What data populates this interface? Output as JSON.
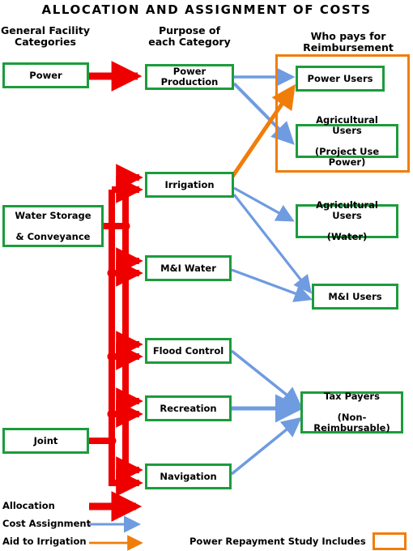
{
  "title": "ALLOCATION AND ASSIGNMENT OF COSTS",
  "columns": {
    "facility": "General Facility\nCategories",
    "purpose": "Purpose of\neach Category",
    "payer": "Who pays for\nReimbursement"
  },
  "column_headers": {
    "c1_line1": "General Facility",
    "c1_line2": "Categories",
    "c2_line1": "Purpose of",
    "c2_line2": "each Category",
    "c3_line1": "Who pays for",
    "c3_line2": "Reimbursement"
  },
  "facility_nodes": [
    {
      "id": "power",
      "label": "Power"
    },
    {
      "id": "water-storage",
      "label_line1": "Water Storage",
      "label_line2": "& Conveyance"
    },
    {
      "id": "joint",
      "label": "Joint"
    }
  ],
  "purpose_nodes": [
    {
      "id": "power-production",
      "label": "Power Production"
    },
    {
      "id": "irrigation",
      "label": "Irrigation"
    },
    {
      "id": "mi-water",
      "label": "M&I Water"
    },
    {
      "id": "flood-control",
      "label": "Flood Control"
    },
    {
      "id": "recreation",
      "label": "Recreation"
    },
    {
      "id": "navigation",
      "label": "Navigation"
    }
  ],
  "payer_nodes": [
    {
      "id": "power-users",
      "label": "Power Users"
    },
    {
      "id": "ag-users-project",
      "label_line1": "Agricultural Users",
      "label_line2": "(Project Use Power)"
    },
    {
      "id": "ag-users-water",
      "label_line1": "Agricultural Users",
      "label_line2": "(Water)"
    },
    {
      "id": "mi-users",
      "label": "M&I Users"
    },
    {
      "id": "tax-payers",
      "label_line1": "Tax Payers",
      "label_line2": "(Non-Reimbursable)"
    }
  ],
  "legend": {
    "allocation": "Allocation",
    "cost_assignment": "Cost Assignment",
    "aid_to_irrigation": "Aid to Irrigation",
    "power_repayment": "Power Repayment Study Includes"
  },
  "colors": {
    "allocation": "#ee0000",
    "cost_assignment": "#6f9be0",
    "aid_to_irrigation": "#f07d0a",
    "node_border": "#1c9c3c",
    "frame": "#f07d0a",
    "text": "#000000",
    "background": "#ffffff"
  },
  "flows": {
    "allocation": [
      {
        "from": "power",
        "to": "power-production"
      },
      {
        "from": "water-storage",
        "to": "irrigation"
      },
      {
        "from": "water-storage",
        "to": "mi-water"
      },
      {
        "from": "water-storage",
        "to": "flood-control"
      },
      {
        "from": "water-storage",
        "to": "recreation"
      },
      {
        "from": "water-storage",
        "to": "navigation"
      },
      {
        "from": "joint",
        "to": "irrigation"
      },
      {
        "from": "joint",
        "to": "mi-water"
      },
      {
        "from": "joint",
        "to": "flood-control"
      },
      {
        "from": "joint",
        "to": "recreation"
      },
      {
        "from": "joint",
        "to": "navigation"
      }
    ],
    "cost_assignment": [
      {
        "from": "power-production",
        "to": "power-users"
      },
      {
        "from": "power-production",
        "to": "ag-users-project"
      },
      {
        "from": "irrigation",
        "to": "ag-users-water"
      },
      {
        "from": "irrigation",
        "to": "mi-users"
      },
      {
        "from": "mi-water",
        "to": "mi-users"
      },
      {
        "from": "flood-control",
        "to": "tax-payers"
      },
      {
        "from": "recreation",
        "to": "tax-payers"
      },
      {
        "from": "navigation",
        "to": "tax-payers"
      }
    ],
    "aid_to_irrigation": [
      {
        "from": "irrigation",
        "to": "power-users"
      }
    ]
  }
}
